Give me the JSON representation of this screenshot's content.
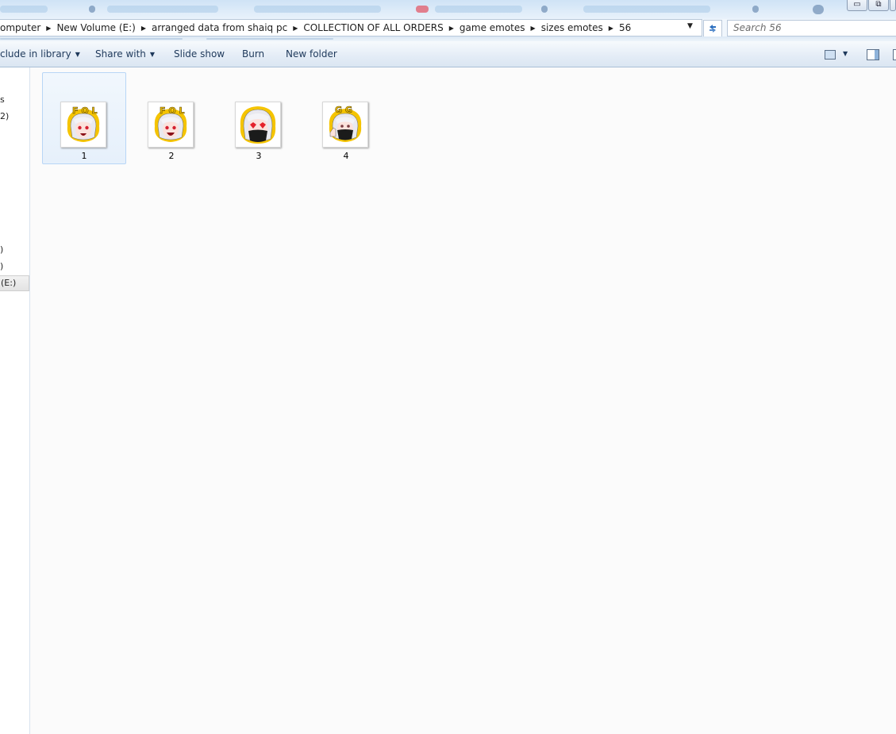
{
  "window": {
    "minimize_label": "▭",
    "restore_label": "⧉"
  },
  "address": {
    "crumbs": [
      "omputer",
      "New Volume (E:)",
      "arranged data from shaiq pc",
      "COLLECTION OF ALL ORDERS",
      "game emotes",
      "sizes emotes",
      "56"
    ],
    "dropdown_icon": "chevron-down-icon",
    "refresh_icon": "refresh-icon"
  },
  "search": {
    "placeholder": "Search 56"
  },
  "toolbar": {
    "include_label": "clude in library",
    "share_label": "Share with",
    "slideshow_label": "Slide show",
    "burn_label": "Burn",
    "newfolder_label": "New folder",
    "view_icon": "change-view-icon",
    "preview_icon": "preview-pane-icon"
  },
  "nav": {
    "items": [
      "s",
      "2)",
      ")",
      ")",
      "(E:)"
    ],
    "selected_index": 4
  },
  "files": [
    {
      "name": "1",
      "emote": "fo-laugh",
      "selected": true
    },
    {
      "name": "2",
      "emote": "fo-laugh-2",
      "selected": false
    },
    {
      "name": "3",
      "emote": "heart-eyes-mask",
      "selected": false
    },
    {
      "name": "4",
      "emote": "gg-thumbs-up-mask",
      "selected": false
    }
  ],
  "colors": {
    "accent": "#1e395b",
    "selection": "#e6f0fb",
    "emote_gold": "#f5c400",
    "emote_hair": "#e9e9ef",
    "emote_heart": "#e4222b"
  }
}
